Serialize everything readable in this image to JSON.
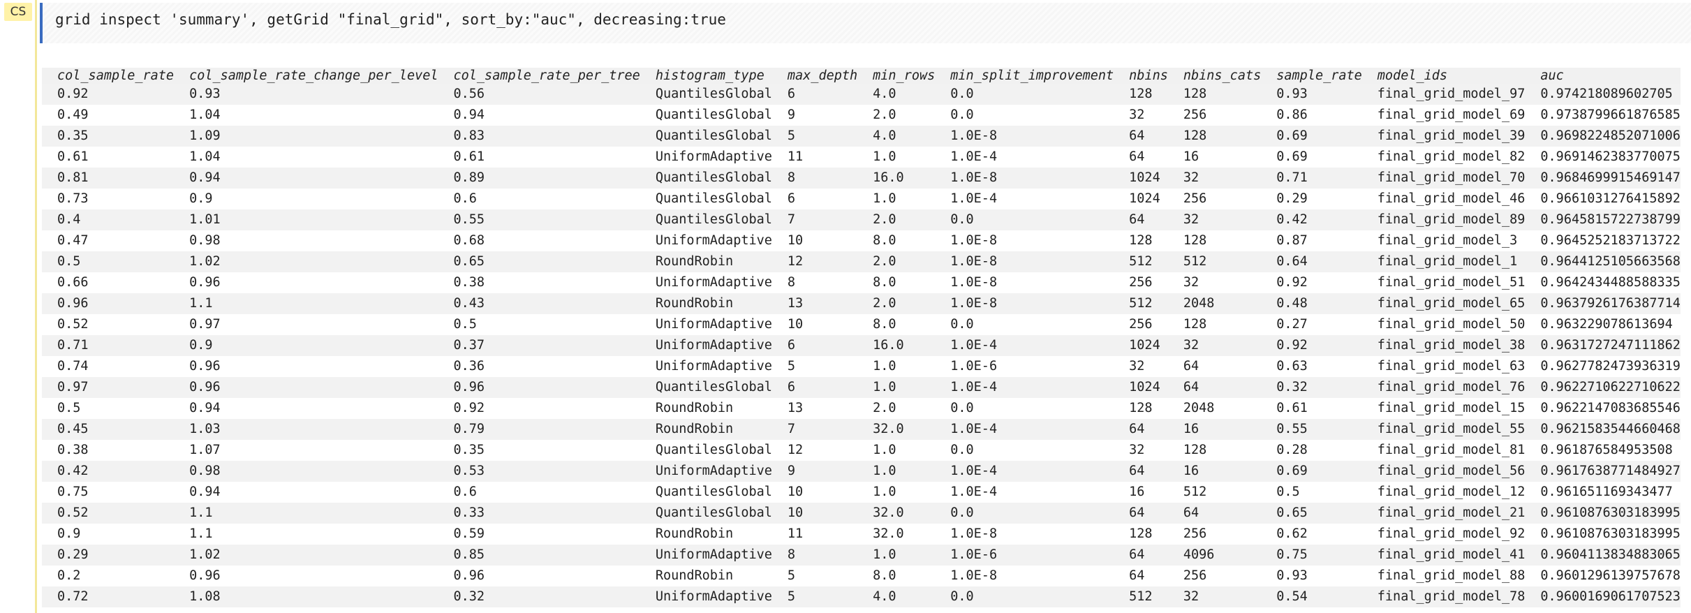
{
  "cell": {
    "badge": "CS",
    "code": "grid inspect 'summary', getGrid \"final_grid\", sort_by:\"auc\", decreasing:true"
  },
  "table": {
    "columns": [
      "col_sample_rate",
      "col_sample_rate_change_per_level",
      "col_sample_rate_per_tree",
      "histogram_type",
      "max_depth",
      "min_rows",
      "min_split_improvement",
      "nbins",
      "nbins_cats",
      "sample_rate",
      "model_ids",
      "auc"
    ],
    "rows": [
      [
        "0.92",
        "0.93",
        "0.56",
        "QuantilesGlobal",
        "6",
        "4.0",
        "0.0",
        "128",
        "128",
        "0.93",
        "final_grid_model_97",
        "0.974218089602705"
      ],
      [
        "0.49",
        "1.04",
        "0.94",
        "QuantilesGlobal",
        "9",
        "2.0",
        "0.0",
        "32",
        "256",
        "0.86",
        "final_grid_model_69",
        "0.9738799661876585"
      ],
      [
        "0.35",
        "1.09",
        "0.83",
        "QuantilesGlobal",
        "5",
        "4.0",
        "1.0E-8",
        "64",
        "128",
        "0.69",
        "final_grid_model_39",
        "0.9698224852071006"
      ],
      [
        "0.61",
        "1.04",
        "0.61",
        "UniformAdaptive",
        "11",
        "1.0",
        "1.0E-4",
        "64",
        "16",
        "0.69",
        "final_grid_model_82",
        "0.9691462383770075"
      ],
      [
        "0.81",
        "0.94",
        "0.89",
        "QuantilesGlobal",
        "8",
        "16.0",
        "1.0E-8",
        "1024",
        "32",
        "0.71",
        "final_grid_model_70",
        "0.9684699915469147"
      ],
      [
        "0.73",
        "0.9",
        "0.6",
        "QuantilesGlobal",
        "6",
        "1.0",
        "1.0E-4",
        "1024",
        "256",
        "0.29",
        "final_grid_model_46",
        "0.9661031276415892"
      ],
      [
        "0.4",
        "1.01",
        "0.55",
        "QuantilesGlobal",
        "7",
        "2.0",
        "0.0",
        "64",
        "32",
        "0.42",
        "final_grid_model_89",
        "0.9645815722738799"
      ],
      [
        "0.47",
        "0.98",
        "0.68",
        "UniformAdaptive",
        "10",
        "8.0",
        "1.0E-8",
        "128",
        "128",
        "0.87",
        "final_grid_model_3",
        "0.9645252183713722"
      ],
      [
        "0.5",
        "1.02",
        "0.65",
        "RoundRobin",
        "12",
        "2.0",
        "1.0E-8",
        "512",
        "512",
        "0.64",
        "final_grid_model_1",
        "0.9644125105663568"
      ],
      [
        "0.66",
        "0.96",
        "0.38",
        "UniformAdaptive",
        "8",
        "8.0",
        "1.0E-8",
        "256",
        "32",
        "0.92",
        "final_grid_model_51",
        "0.9642434488588335"
      ],
      [
        "0.96",
        "1.1",
        "0.43",
        "RoundRobin",
        "13",
        "2.0",
        "1.0E-8",
        "512",
        "2048",
        "0.48",
        "final_grid_model_65",
        "0.9637926176387714"
      ],
      [
        "0.52",
        "0.97",
        "0.5",
        "UniformAdaptive",
        "10",
        "8.0",
        "0.0",
        "256",
        "128",
        "0.27",
        "final_grid_model_50",
        "0.963229078613694"
      ],
      [
        "0.71",
        "0.9",
        "0.37",
        "UniformAdaptive",
        "6",
        "16.0",
        "1.0E-4",
        "1024",
        "32",
        "0.92",
        "final_grid_model_38",
        "0.9631727247111862"
      ],
      [
        "0.74",
        "0.96",
        "0.36",
        "UniformAdaptive",
        "5",
        "1.0",
        "1.0E-6",
        "32",
        "64",
        "0.63",
        "final_grid_model_63",
        "0.9627782473936319"
      ],
      [
        "0.97",
        "0.96",
        "0.96",
        "QuantilesGlobal",
        "6",
        "1.0",
        "1.0E-4",
        "1024",
        "64",
        "0.32",
        "final_grid_model_76",
        "0.9622710622710622"
      ],
      [
        "0.5",
        "0.94",
        "0.92",
        "RoundRobin",
        "13",
        "2.0",
        "0.0",
        "128",
        "2048",
        "0.61",
        "final_grid_model_15",
        "0.9622147083685546"
      ],
      [
        "0.45",
        "1.03",
        "0.79",
        "RoundRobin",
        "7",
        "32.0",
        "1.0E-4",
        "64",
        "16",
        "0.55",
        "final_grid_model_55",
        "0.9621583544660468"
      ],
      [
        "0.38",
        "1.07",
        "0.35",
        "QuantilesGlobal",
        "12",
        "1.0",
        "0.0",
        "32",
        "128",
        "0.28",
        "final_grid_model_81",
        "0.961876584953508"
      ],
      [
        "0.42",
        "0.98",
        "0.53",
        "UniformAdaptive",
        "9",
        "1.0",
        "1.0E-4",
        "64",
        "16",
        "0.69",
        "final_grid_model_56",
        "0.9617638771484927"
      ],
      [
        "0.75",
        "0.94",
        "0.6",
        "QuantilesGlobal",
        "10",
        "1.0",
        "1.0E-4",
        "16",
        "512",
        "0.5",
        "final_grid_model_12",
        "0.961651169343477"
      ],
      [
        "0.52",
        "1.1",
        "0.33",
        "QuantilesGlobal",
        "10",
        "32.0",
        "0.0",
        "64",
        "64",
        "0.65",
        "final_grid_model_21",
        "0.9610876303183995"
      ],
      [
        "0.9",
        "1.1",
        "0.59",
        "RoundRobin",
        "11",
        "32.0",
        "1.0E-8",
        "128",
        "256",
        "0.62",
        "final_grid_model_92",
        "0.9610876303183995"
      ],
      [
        "0.29",
        "1.02",
        "0.85",
        "UniformAdaptive",
        "8",
        "1.0",
        "1.0E-6",
        "64",
        "4096",
        "0.75",
        "final_grid_model_41",
        "0.9604113834883065"
      ],
      [
        "0.2",
        "0.96",
        "0.96",
        "RoundRobin",
        "5",
        "8.0",
        "1.0E-8",
        "64",
        "256",
        "0.93",
        "final_grid_model_88",
        "0.9601296139757678"
      ],
      [
        "0.72",
        "1.08",
        "0.32",
        "UniformAdaptive",
        "5",
        "4.0",
        "0.0",
        "512",
        "32",
        "0.54",
        "final_grid_model_78",
        "0.9600169061707523"
      ]
    ]
  }
}
